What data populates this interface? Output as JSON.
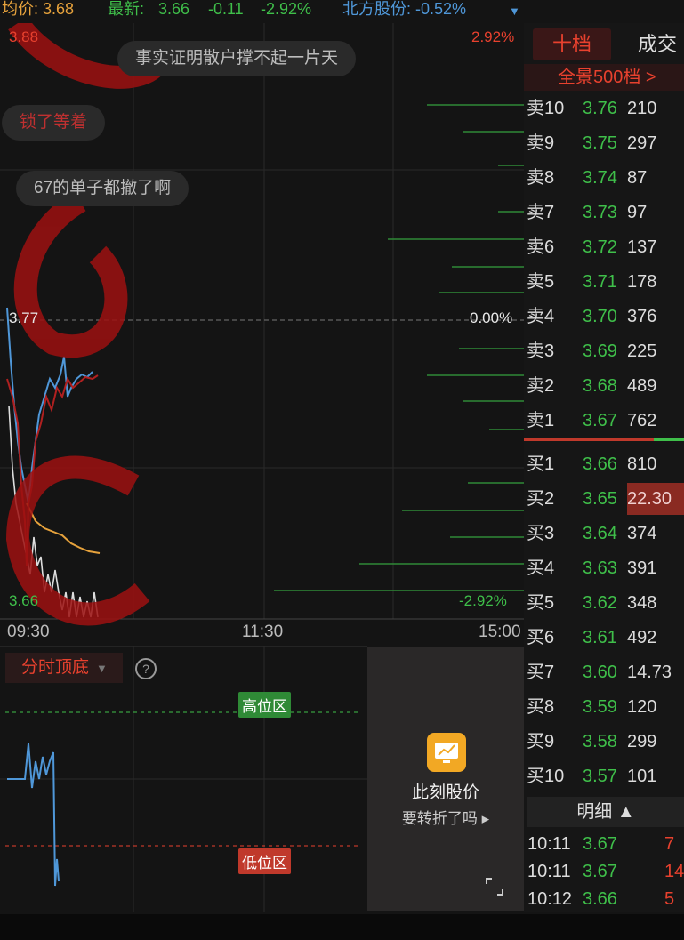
{
  "topbar": {
    "avg_label": "均价: 3.68",
    "latest_label": "最新: ",
    "latest_value": "3.66",
    "change": "-0.11",
    "change_pct": "-2.92%",
    "index_label": "北方股份: -0.52%"
  },
  "chart": {
    "price_high": "3.88",
    "pct_high": "2.92%",
    "price_mid": "3.77",
    "pct_mid": "0.00%",
    "price_low": "3.66",
    "pct_low": "-2.92%",
    "times": [
      "09:30",
      "11:30",
      "15:00"
    ],
    "bubbles": [
      "事实证明散户撑不起一片天",
      "锁了等着",
      "67的单子都撤了啊"
    ]
  },
  "indicator": {
    "title": "分时顶底",
    "high_zone": "高位区",
    "low_zone": "低位区"
  },
  "promo": {
    "title": "此刻股价",
    "subtitle": "要转折了吗 ▸"
  },
  "book": {
    "tab_active": "十档",
    "tab_other": "成交",
    "panorama": "全景500档 >",
    "asks": [
      {
        "label": "卖10",
        "price": "3.76",
        "vol": "210"
      },
      {
        "label": "卖9",
        "price": "3.75",
        "vol": "297"
      },
      {
        "label": "卖8",
        "price": "3.74",
        "vol": "87"
      },
      {
        "label": "卖7",
        "price": "3.73",
        "vol": "97"
      },
      {
        "label": "卖6",
        "price": "3.72",
        "vol": "137"
      },
      {
        "label": "卖5",
        "price": "3.71",
        "vol": "178"
      },
      {
        "label": "卖4",
        "price": "3.70",
        "vol": "376"
      },
      {
        "label": "卖3",
        "price": "3.69",
        "vol": "225"
      },
      {
        "label": "卖2",
        "price": "3.68",
        "vol": "489"
      },
      {
        "label": "卖1",
        "price": "3.67",
        "vol": "762"
      }
    ],
    "bids": [
      {
        "label": "买1",
        "price": "3.66",
        "vol": "810"
      },
      {
        "label": "买2",
        "price": "3.65",
        "vol": "22.30"
      },
      {
        "label": "买3",
        "price": "3.64",
        "vol": "374"
      },
      {
        "label": "买4",
        "price": "3.63",
        "vol": "391"
      },
      {
        "label": "买5",
        "price": "3.62",
        "vol": "348"
      },
      {
        "label": "买6",
        "price": "3.61",
        "vol": "492"
      },
      {
        "label": "买7",
        "price": "3.60",
        "vol": "14.73"
      },
      {
        "label": "买8",
        "price": "3.59",
        "vol": "120"
      },
      {
        "label": "买9",
        "price": "3.58",
        "vol": "299"
      },
      {
        "label": "买10",
        "price": "3.57",
        "vol": "101"
      }
    ],
    "detail_label": "明细 ▲",
    "trades": [
      {
        "time": "10:11",
        "price": "3.67",
        "vol": "7"
      },
      {
        "time": "10:11",
        "price": "3.67",
        "vol": "14"
      },
      {
        "time": "10:12",
        "price": "3.66",
        "vol": "5"
      }
    ]
  }
}
